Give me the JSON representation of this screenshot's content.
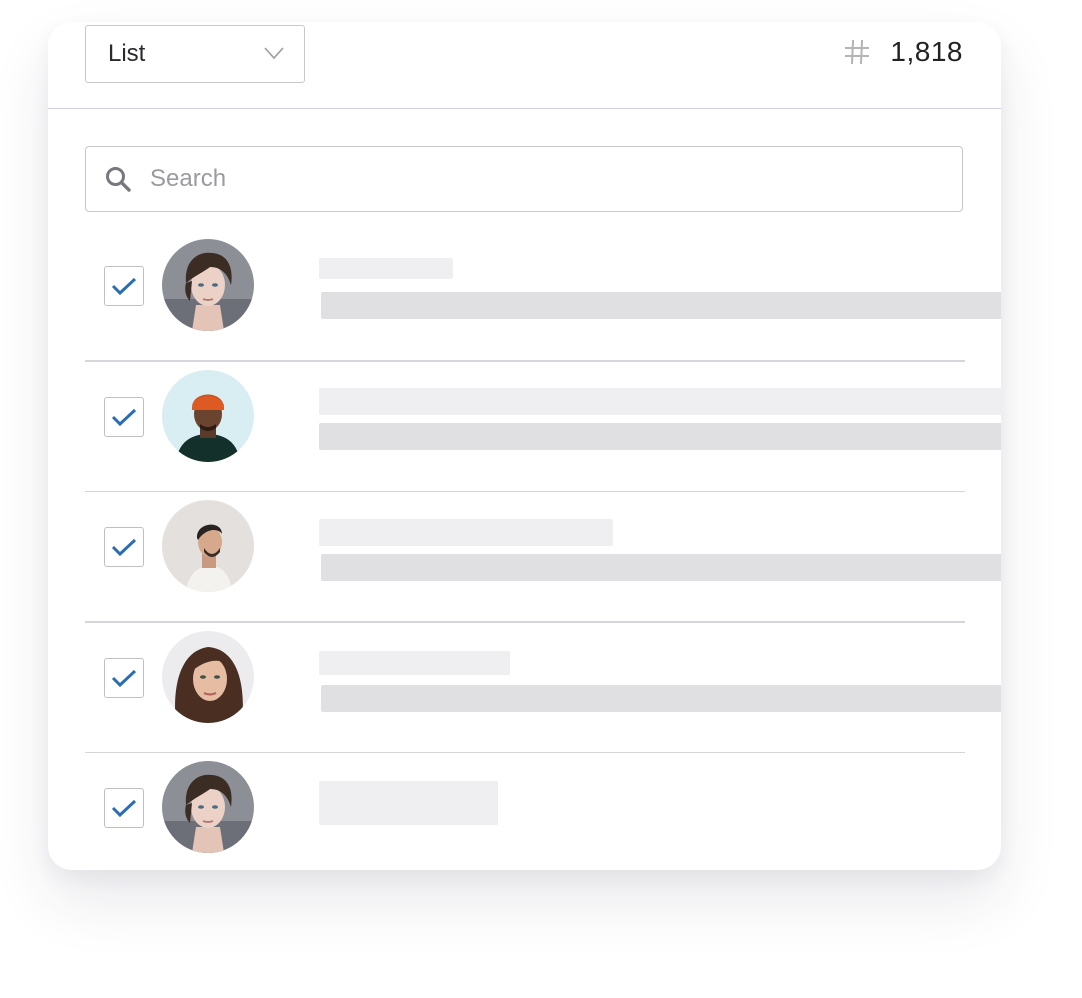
{
  "header": {
    "list_select": {
      "value": "List",
      "icon": "chevron-down-icon"
    },
    "count": {
      "icon": "hash-icon",
      "value": "1,818"
    }
  },
  "search": {
    "placeholder": "Search",
    "value": ""
  },
  "contacts": [
    {
      "checked": true,
      "avatar": "woman-short-brown-hair"
    },
    {
      "checked": true,
      "avatar": "man-orange-beanie"
    },
    {
      "checked": true,
      "avatar": "man-white-turtleneck"
    },
    {
      "checked": true,
      "avatar": "woman-long-brown-hair"
    },
    {
      "checked": true,
      "avatar": "woman-short-brown-hair"
    }
  ],
  "colors": {
    "check_blue": "#2a6db5",
    "skeleton_light": "#efeef1",
    "skeleton_dark": "#e0dfe2",
    "divider": "#d6d6da"
  }
}
